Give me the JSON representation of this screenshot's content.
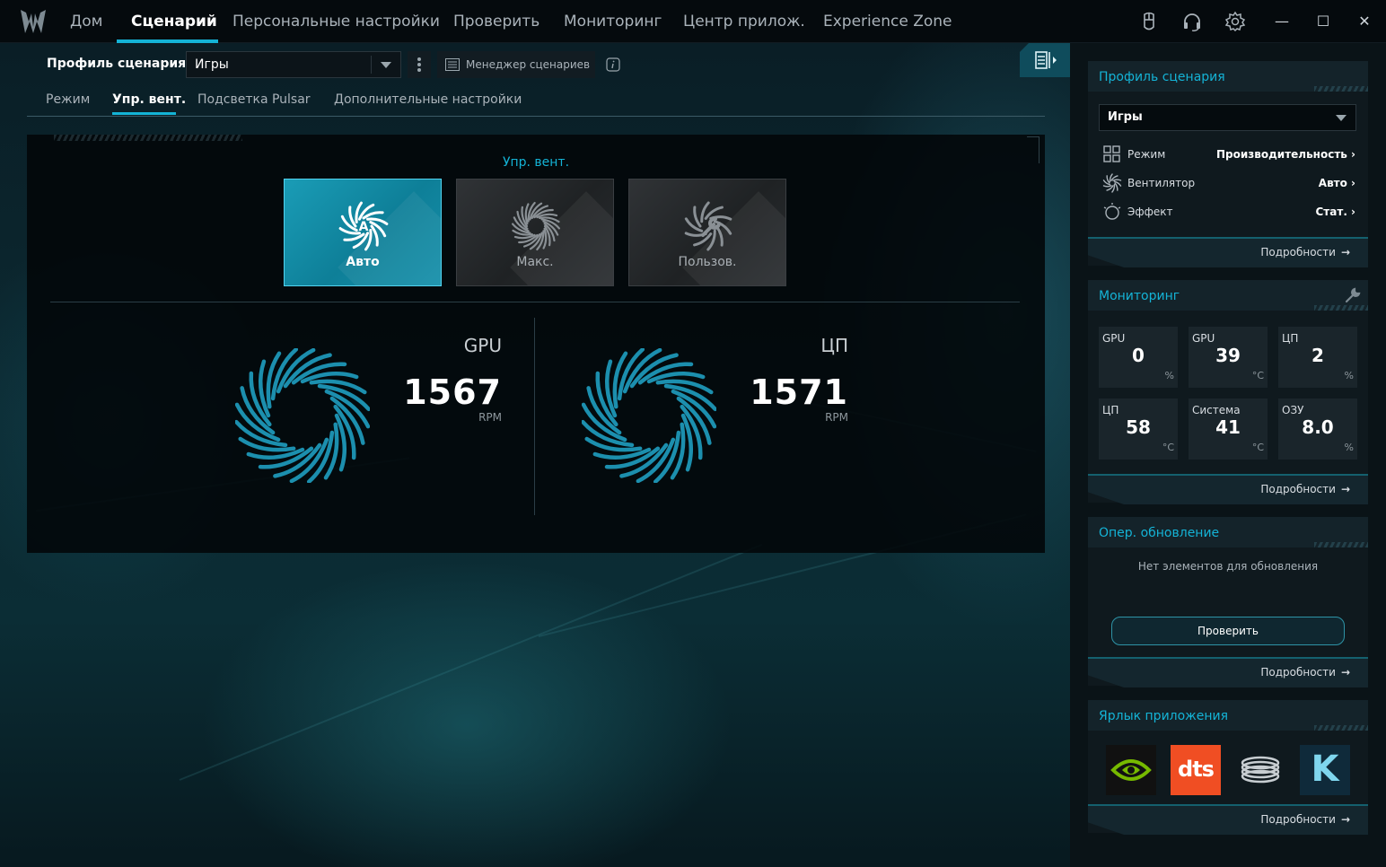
{
  "app": {
    "nav": [
      "Дом",
      "Сценарий",
      "Персональные настройки",
      "Проверить",
      "Мониторинг",
      "Центр прилож.",
      "Experience Zone"
    ],
    "active_nav": 1,
    "window_buttons": {
      "minimize": "—",
      "maximize": "☐",
      "close": "✕"
    }
  },
  "profile": {
    "label": "Профиль сценария",
    "selected": "Игры",
    "manager_label": "Менеджер сценариев"
  },
  "sub_tabs": [
    "Режим",
    "Упр. вент.",
    "Подсветка Pulsar",
    "Дополнительные настройки"
  ],
  "active_sub_tab": 1,
  "fan_control": {
    "title": "Упр. вент.",
    "modes": [
      {
        "label": "Авто",
        "icon": "fan-auto-icon",
        "active": true
      },
      {
        "label": "Макс.",
        "icon": "fan-max-icon",
        "active": false
      },
      {
        "label": "Пользов.",
        "icon": "fan-custom-icon",
        "active": false
      }
    ],
    "fans": [
      {
        "name": "GPU",
        "rpm": "1567",
        "unit": "RPM"
      },
      {
        "name": "ЦП",
        "rpm": "1571",
        "unit": "RPM"
      }
    ]
  },
  "sidebar": {
    "more_label": "Подробности",
    "scenario_card": {
      "title": "Профиль сценария",
      "selected": "Игры",
      "rows": [
        {
          "key": "Режим",
          "value": "Производительность",
          "icon": "grid-icon"
        },
        {
          "key": "Вентилятор",
          "value": "Авто",
          "icon": "fan-icon"
        },
        {
          "key": "Эффект",
          "value": "Стат.",
          "icon": "light-icon"
        }
      ]
    },
    "monitoring_card": {
      "title": "Мониторинг",
      "tiles": [
        {
          "name": "GPU",
          "value": "0",
          "unit": "%"
        },
        {
          "name": "GPU",
          "value": "39",
          "unit": "°C"
        },
        {
          "name": "ЦП",
          "value": "2",
          "unit": "%"
        },
        {
          "name": "ЦП",
          "value": "58",
          "unit": "°C"
        },
        {
          "name": "Система",
          "value": "41",
          "unit": "°C"
        },
        {
          "name": "ОЗУ",
          "value": "8.0",
          "unit": "%"
        }
      ]
    },
    "update_card": {
      "title": "Опер. обновление",
      "message": "Нет элементов для обновления",
      "button": "Проверить"
    },
    "shortcut_card": {
      "title": "Ярлык приложения",
      "apps": [
        "nvidia-icon",
        "dts-icon",
        "coil-icon",
        "killer-icon"
      ],
      "dts_text": "dts",
      "killer_text": "K"
    }
  },
  "colors": {
    "accent": "#14b3d6",
    "nvidia": "#76b900",
    "dts": "#f04e23"
  }
}
